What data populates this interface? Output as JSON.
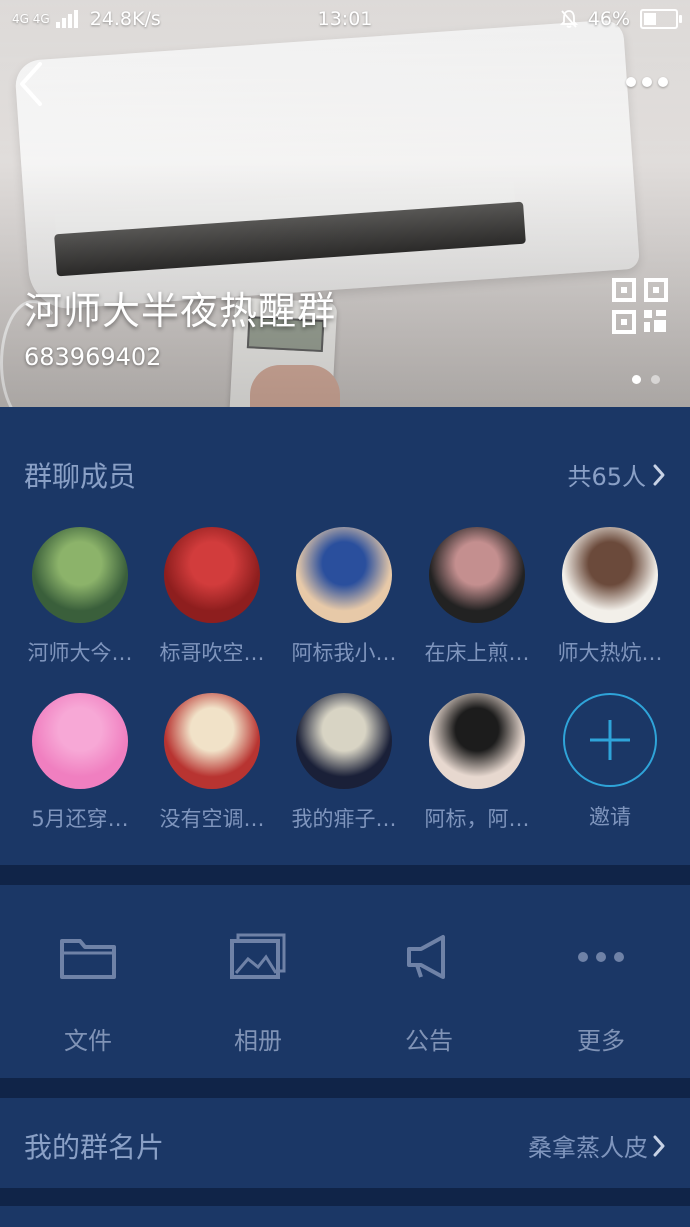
{
  "status_bar": {
    "network": "4G 4G",
    "speed": "24.8K/s",
    "time": "13:01",
    "battery": "46%",
    "battery_level": 0.46
  },
  "header": {
    "group_name": "河师大半夜热醒群",
    "group_id": "683969402",
    "page_dots": 2,
    "active_dot": 0
  },
  "members": {
    "title": "群聊成员",
    "count_label": "共65人",
    "list": [
      {
        "name": "河师大今…",
        "colors": [
          "#3a5f3b",
          "#8cb36a"
        ]
      },
      {
        "name": "标哥吹空…",
        "colors": [
          "#8e1e1e",
          "#d23c3c"
        ]
      },
      {
        "name": "阿标我小…",
        "colors": [
          "#e7c9a8",
          "#2a4f9d"
        ]
      },
      {
        "name": "在床上煎…",
        "colors": [
          "#222222",
          "#c48f8f"
        ]
      },
      {
        "name": "师大热炕…",
        "colors": [
          "#f2efe9",
          "#6b4a3b"
        ]
      },
      {
        "name": "5月还穿…",
        "colors": [
          "#f07fc0",
          "#f7a8d6"
        ]
      },
      {
        "name": "没有空调…",
        "colors": [
          "#b83431",
          "#f1e2c8"
        ]
      },
      {
        "name": "我的痱子…",
        "colors": [
          "#1a2038",
          "#d8d4c4"
        ]
      },
      {
        "name": "阿标，阿…",
        "colors": [
          "#e7d8cf",
          "#1c1c1c"
        ]
      }
    ],
    "invite_label": "邀请"
  },
  "tools": [
    {
      "label": "文件",
      "icon": "folder-icon"
    },
    {
      "label": "相册",
      "icon": "album-icon"
    },
    {
      "label": "公告",
      "icon": "megaphone-icon"
    },
    {
      "label": "更多",
      "icon": "more-icon"
    }
  ],
  "my_card": {
    "label": "我的群名片",
    "value": "桑拿蒸人皮"
  },
  "colors": {
    "panel": "#1b3766",
    "divider": "#102448",
    "text_muted": "#8aa0c6",
    "invite_accent": "#2fa4d9"
  }
}
